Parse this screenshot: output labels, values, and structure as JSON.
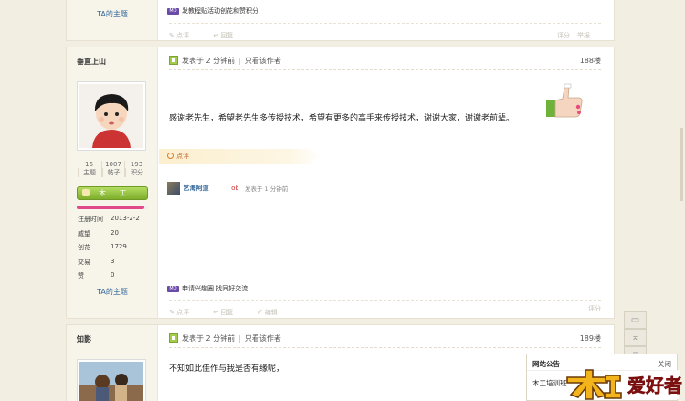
{
  "top_post": {
    "ta_topics_label": "TA的主题",
    "medal_text": "发教程贴活动创花和赞积分",
    "actions": [
      "点评",
      "回复"
    ],
    "right_actions": [
      "评分",
      "举报"
    ]
  },
  "post_188": {
    "username": "垂直上山",
    "time": "发表于 2 分钟前",
    "only_author": "只看该作者",
    "floor": "188楼",
    "content": "感谢老先生，希望老先生多传授技术，希望有更多的高手来传授技术，谢谢大家，谢谢老前辈。",
    "stats": [
      {
        "num": "16",
        "label": "主题"
      },
      {
        "num": "1007",
        "label": "帖子"
      },
      {
        "num": "193",
        "label": "积分"
      }
    ],
    "group": "木 工",
    "group_progress_pct": 95,
    "infos": [
      {
        "k": "注册时间",
        "v": "2013-2-2"
      },
      {
        "k": "威望",
        "v": "20"
      },
      {
        "k": "创花",
        "v": "1729"
      },
      {
        "k": "交易",
        "v": "3"
      },
      {
        "k": "赞",
        "v": "0"
      }
    ],
    "ta_topics_label": "TA的主题",
    "comment_label": "点评",
    "comment": {
      "user": "艺海阿道",
      "text": "ok",
      "time": "发表于 1 分钟前"
    },
    "medal_text": "申请兴趣圈 找同好交流",
    "actions": [
      "点评",
      "回复",
      "编辑"
    ],
    "right_action": "评分"
  },
  "post_189": {
    "username": "知影",
    "time": "发表于 2 分钟前",
    "only_author": "只看该作者",
    "floor": "189楼",
    "content": "不知如此佳作与我是否有缘呢，"
  },
  "notice": {
    "title": "网站公告",
    "close": "关闭",
    "item": "木工培训班"
  },
  "logo_text": "木工爱好者",
  "colors": {
    "group_button": "#8fbf3c",
    "progress": "#e04a8a",
    "link": "#336699"
  }
}
